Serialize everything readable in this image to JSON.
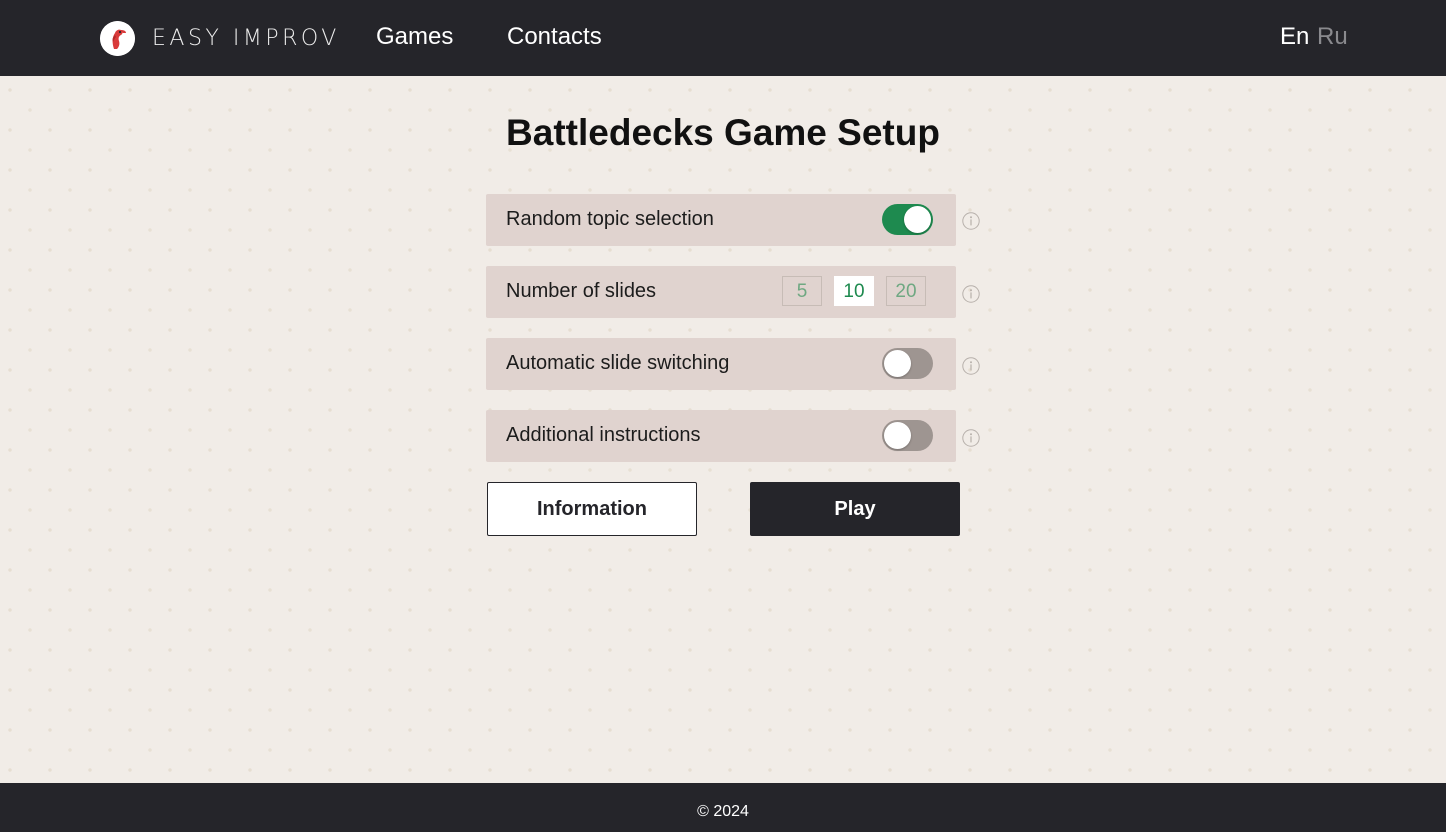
{
  "header": {
    "logo_text": "EASY IMPROV",
    "nav": {
      "games": "Games",
      "contacts": "Contacts"
    },
    "languages": {
      "en": "En",
      "ru": "Ru",
      "selected": "En"
    }
  },
  "main": {
    "title": "Battledecks Game Setup",
    "settings": [
      {
        "label": "Random topic selection",
        "enabled": true
      },
      {
        "label": "Number of slides",
        "options": [
          "5",
          "10",
          "20"
        ],
        "selected": "10"
      },
      {
        "label": "Automatic slide switching",
        "enabled": false
      },
      {
        "label": "Additional instructions",
        "enabled": false
      }
    ],
    "buttons": {
      "information": "Information",
      "play": "Play"
    }
  },
  "footer": {
    "copyright": "© 2024"
  },
  "colors": {
    "header_bg": "#25252a",
    "page_bg": "#f1ece7",
    "row_bg": "#e0d3cf",
    "accent_green": "#1e8a4f",
    "toggle_off": "#9e9591"
  },
  "icons": [
    "turkey-logo-icon",
    "info-icon"
  ]
}
